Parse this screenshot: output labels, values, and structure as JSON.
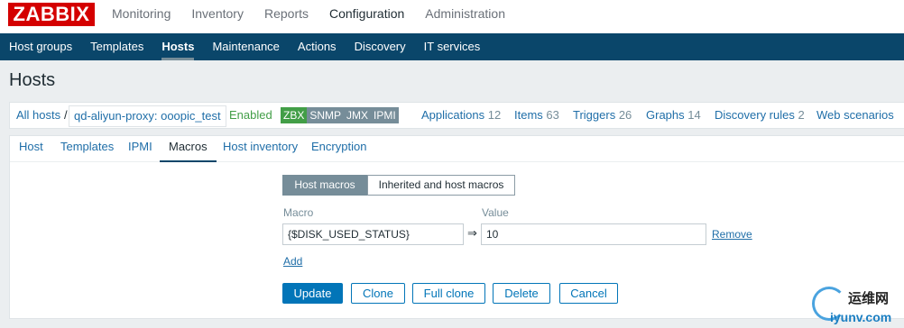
{
  "brand": {
    "logo": "ZABBIX"
  },
  "top_nav": [
    "Monitoring",
    "Inventory",
    "Reports",
    "Configuration",
    "Administration"
  ],
  "top_nav_active": "Configuration",
  "sub_nav": [
    "Host groups",
    "Templates",
    "Hosts",
    "Maintenance",
    "Actions",
    "Discovery",
    "IT services"
  ],
  "sub_nav_active": "Hosts",
  "page_title": "Hosts",
  "host_bar": {
    "all_hosts": "All hosts",
    "separator": "/",
    "host_name": "qd-aliyun-proxy: ooopic_test",
    "status": "Enabled",
    "availability": [
      "ZBX",
      "SNMP",
      "JMX",
      "IPMI"
    ],
    "links": [
      {
        "label": "Applications",
        "count": "12"
      },
      {
        "label": "Items",
        "count": "63"
      },
      {
        "label": "Triggers",
        "count": "26"
      },
      {
        "label": "Graphs",
        "count": "14"
      },
      {
        "label": "Discovery rules",
        "count": "2"
      },
      {
        "label": "Web scenarios",
        "count": ""
      }
    ]
  },
  "tabs": [
    "Host",
    "Templates",
    "IPMI",
    "Macros",
    "Host inventory",
    "Encryption"
  ],
  "tabs_active": "Macros",
  "macro_toggle": {
    "host_macros": "Host macros",
    "inherited": "Inherited and host macros"
  },
  "macro_form": {
    "macro_label": "Macro",
    "value_label": "Value",
    "macro_value": "{$DISK_USED_STATUS}",
    "value_value": "10",
    "arrow": "⇒",
    "remove": "Remove",
    "add": "Add"
  },
  "buttons": {
    "update": "Update",
    "clone": "Clone",
    "full_clone": "Full clone",
    "delete": "Delete",
    "cancel": "Cancel"
  },
  "watermark": {
    "cn": "运维网",
    "en": "iyunv.com"
  },
  "colors": {
    "header_bg": "#0a466a",
    "logo_red": "#d40000",
    "link": "#1f6ea8",
    "enabled_green": "#429e47",
    "button_blue": "#0275b8"
  }
}
